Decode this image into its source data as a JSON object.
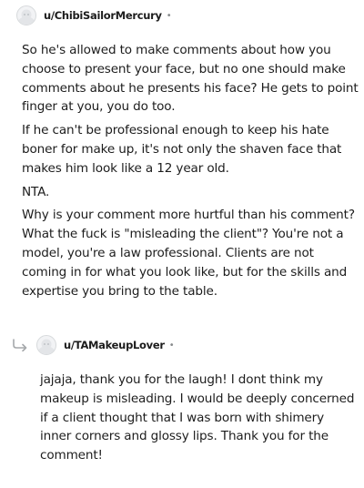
{
  "comment1": {
    "username": "u/ChibiSailorMercury",
    "separator": "•",
    "paragraphs": [
      "So he's allowed to make comments about how you choose to present your face, but no one should make comments about he presents his face? He gets to point finger at you, you do too.",
      "If he can't be professional enough to keep his hate boner for make up, it's not only the shaven face that makes him look like a 12 year old.",
      "NTA.",
      "Why is your comment more hurtful than his comment? What the fuck is \"misleading the client\"? You're not a model, you're a law professional. Clients are not coming in for what you look like, but for the skills and expertise you bring to the table."
    ]
  },
  "comment2": {
    "username": "u/TAMakeupLover",
    "separator": "•",
    "paragraphs": [
      "jajaja, thank you for the laugh! I dont think my makeup is misleading. I would be deeply concerned if a client thought that I was born with shimery inner corners and glossy lips. Thank you for the comment!"
    ]
  },
  "icons": {
    "avatar": "snoo-avatar-icon",
    "reply": "reply-arrow-icon"
  },
  "colors": {
    "text": "#1c1c1c",
    "meta": "#878a8c",
    "background": "#ffffff"
  }
}
